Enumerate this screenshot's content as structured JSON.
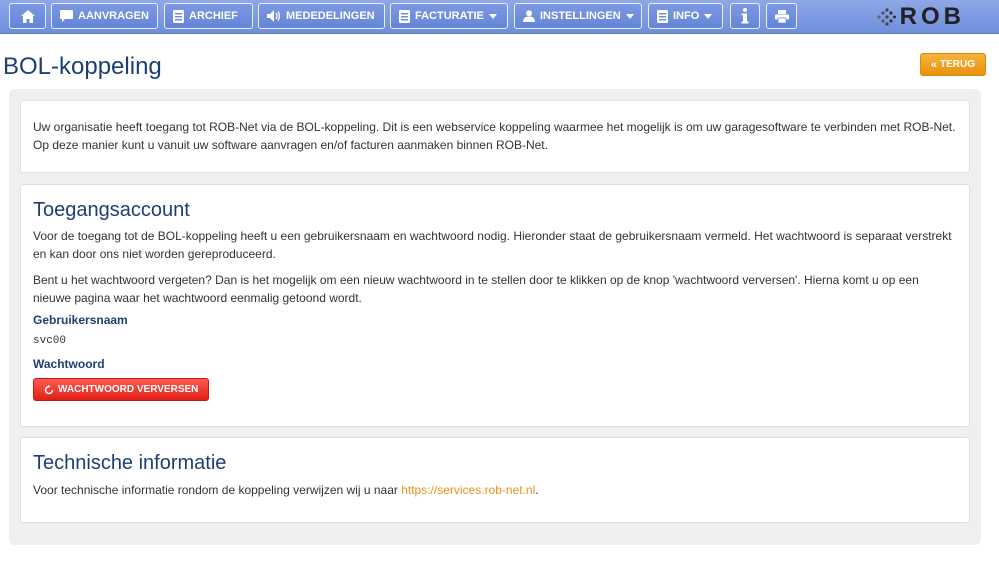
{
  "nav": {
    "items": [
      {
        "label": "AANVRAGEN"
      },
      {
        "label": "ARCHIEF"
      },
      {
        "label": "MEDEDELINGEN"
      },
      {
        "label": "FACTURATIE"
      },
      {
        "label": "INSTELLINGEN"
      },
      {
        "label": "INFO"
      }
    ],
    "logo": "ROB"
  },
  "page": {
    "title": "BOL-koppeling",
    "back_label": "TERUG"
  },
  "intro": {
    "text": "Uw organisatie heeft toegang tot ROB-Net via de BOL-koppeling. Dit is een webservice koppeling waarmee het mogelijk is om uw garagesoftware te verbinden met ROB-Net. Op deze manier kunt u vanuit uw software aanvragen en/of facturen aanmaken binnen ROB-Net."
  },
  "account": {
    "heading": "Toegangsaccount",
    "para1": "Voor de toegang tot de BOL-koppeling heeft u een gebruikersnaam en wachtwoord nodig. Hieronder staat de gebruikersnaam vermeld. Het wachtwoord is separaat verstrekt en kan door ons niet worden gereproduceerd.",
    "para2": "Bent u het wachtwoord vergeten? Dan is het mogelijk om een nieuw wachtwoord in te stellen door te klikken op de knop 'wachtwoord verversen'. Hierna komt u op een nieuwe pagina waar het wachtwoord eenmalig getoond wordt.",
    "username_label": "Gebruikersnaam",
    "username_value": "svc00",
    "password_label": "Wachtwoord",
    "refresh_button": "WACHTWOORD VERVERSEN"
  },
  "tech": {
    "heading": "Technische informatie",
    "text_before": "Voor technische informatie rondom de koppeling verwijzen wij u naar ",
    "link": "https://services.rob-net.nl",
    "text_after": "."
  },
  "colors": {
    "nav_bg": "#6f8fdc",
    "title": "#1e3f73",
    "back_button": "#e8920f",
    "refresh_button": "#e01f17",
    "link": "#e89417"
  }
}
